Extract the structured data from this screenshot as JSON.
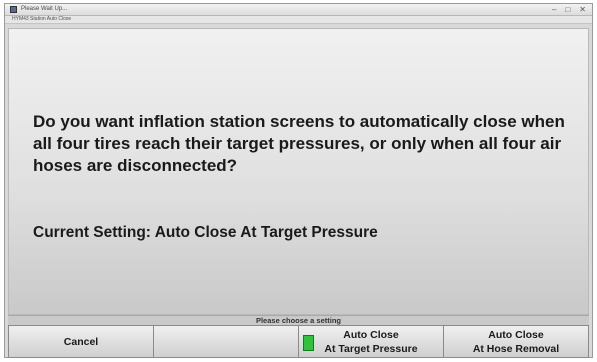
{
  "window": {
    "title": "Please Wait Up...",
    "controls": {
      "minimize": "–",
      "maximize": "□",
      "close": "✕"
    }
  },
  "screen_id": "HYM43 Station Auto Close",
  "main": {
    "question": "Do you want inflation station screens to automatically close when all four tires reach their target pressures, or only when all four air hoses are disconnected?",
    "current_setting": "Current Setting: Auto Close At Target Pressure"
  },
  "status": {
    "prompt": "Please choose a setting"
  },
  "softkeys": [
    {
      "line1": "Cancel",
      "line2": ""
    },
    {
      "line1": "",
      "line2": ""
    },
    {
      "line1": "Auto Close",
      "line2": "At Target Pressure",
      "selected": true
    },
    {
      "line1": "Auto Close",
      "line2": "At Hose Removal"
    }
  ],
  "colors": {
    "selected_indicator": "#2fc23a",
    "background": "#e0e0e0",
    "text": "#1a1a1a"
  },
  "icons": {
    "app": "app-icon",
    "selected": "green-indicator-icon"
  }
}
